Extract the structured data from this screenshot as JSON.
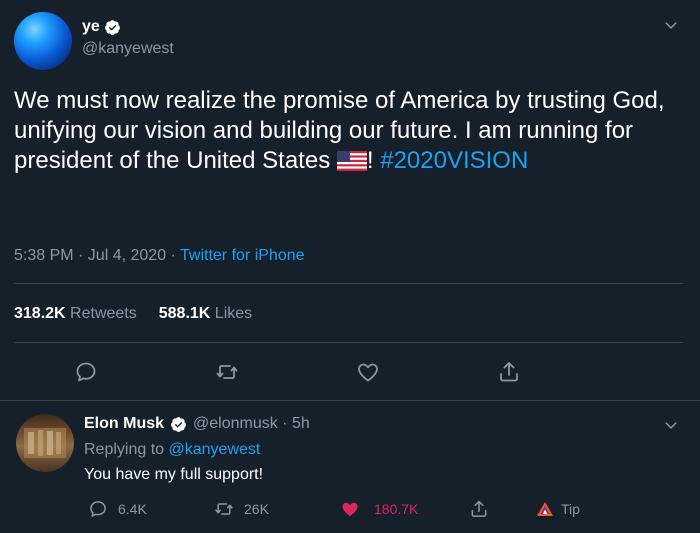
{
  "tweet": {
    "display_name": "ye",
    "handle": "@kanyewest",
    "text_main": "We must now realize the promise of America by trusting God, unifying our vision and building our future. I am running for president of the United States",
    "flag_emoji": "🇺🇸",
    "exclamation": "!",
    "hashtag": "#2020VISION",
    "time": "5:38 PM · Jul 4, 2020 · ",
    "source": "Twitter for iPhone",
    "retweets_count": "318.2K",
    "retweets_label": "Retweets",
    "likes_count": "588.1K",
    "likes_label": "Likes"
  },
  "reply": {
    "display_name": "Elon Musk",
    "handle": "@elonmusk · 5h",
    "replying_prefix": "Replying to ",
    "replying_to": "@kanyewest",
    "text": "You have my full support!",
    "reply_count": "6.4K",
    "retweet_count": "26K",
    "like_count": "180.7K",
    "tip_label": "Tip"
  },
  "colors": {
    "background": "#15202b",
    "accent": "#1da1f2",
    "muted": "#8899a6",
    "like": "#e0245e",
    "divider": "#38444d"
  },
  "icons": [
    "verified-badge-icon",
    "chevron-down-icon",
    "reply-icon",
    "retweet-icon",
    "like-icon",
    "share-icon",
    "tip-icon",
    "flag-us-icon"
  ]
}
